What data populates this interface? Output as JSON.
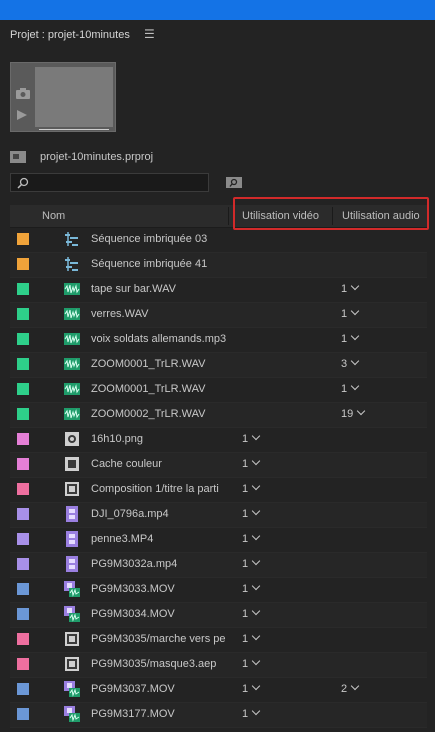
{
  "panel": {
    "title": "Projet : projet-10minutes",
    "menu_icon": "hamburger-icon",
    "project_file": "projet-10minutes.prproj",
    "search_placeholder": ""
  },
  "columns": {
    "name": "Nom",
    "video_usage": "Utilisation vidéo",
    "audio_usage": "Utilisation audio"
  },
  "colors": {
    "accent": "#1473e6",
    "highlight": "#d22a2a",
    "orange": "#f0a33a",
    "green": "#2ecf8a",
    "pink": "#e57fd6",
    "rose": "#ee6f9f",
    "lavender": "#a890e8",
    "blue": "#6b97d6"
  },
  "items": [
    {
      "name": "Séquence imbriquée 03",
      "icon": "sequence-icon",
      "label_color": "orange",
      "video": "",
      "audio": ""
    },
    {
      "name": "Séquence imbriquée 41",
      "icon": "sequence-icon",
      "label_color": "orange",
      "video": "",
      "audio": ""
    },
    {
      "name": "tape sur bar.WAV",
      "icon": "audio-icon",
      "label_color": "green",
      "video": "",
      "audio": "1"
    },
    {
      "name": "verres.WAV",
      "icon": "audio-icon",
      "label_color": "green",
      "video": "",
      "audio": "1"
    },
    {
      "name": "voix soldats allemands.mp3",
      "icon": "audio-icon",
      "label_color": "green",
      "video": "",
      "audio": "1"
    },
    {
      "name": "ZOOM0001_TrLR.WAV",
      "icon": "audio-icon",
      "label_color": "green",
      "video": "",
      "audio": "3"
    },
    {
      "name": "ZOOM0001_TrLR.WAV",
      "icon": "audio-icon",
      "label_color": "green",
      "video": "",
      "audio": "1"
    },
    {
      "name": "ZOOM0002_TrLR.WAV",
      "icon": "audio-icon",
      "label_color": "green",
      "video": "",
      "audio": "19"
    },
    {
      "name": "16h10.png",
      "icon": "image-icon",
      "label_color": "pink",
      "video": "1",
      "audio": ""
    },
    {
      "name": "Cache couleur",
      "icon": "color-matte-icon",
      "label_color": "pink",
      "video": "1",
      "audio": ""
    },
    {
      "name": "Composition 1/titre la parti",
      "icon": "composition-icon",
      "label_color": "rose",
      "video": "1",
      "audio": ""
    },
    {
      "name": "DJI_0796a.mp4",
      "icon": "video-icon",
      "label_color": "lavender",
      "video": "1",
      "audio": ""
    },
    {
      "name": "penne3.MP4",
      "icon": "video-icon",
      "label_color": "lavender",
      "video": "1",
      "audio": ""
    },
    {
      "name": "PG9M3032a.mp4",
      "icon": "video-icon",
      "label_color": "lavender",
      "video": "1",
      "audio": ""
    },
    {
      "name": "PG9M3033.MOV",
      "icon": "av-clip-icon",
      "label_color": "blue",
      "video": "1",
      "audio": ""
    },
    {
      "name": "PG9M3034.MOV",
      "icon": "av-clip-icon",
      "label_color": "blue",
      "video": "1",
      "audio": ""
    },
    {
      "name": "PG9M3035/marche vers pe",
      "icon": "composition-icon",
      "label_color": "rose",
      "video": "1",
      "audio": ""
    },
    {
      "name": "PG9M3035/masque3.aep",
      "icon": "composition-icon",
      "label_color": "rose",
      "video": "1",
      "audio": ""
    },
    {
      "name": "PG9M3037.MOV",
      "icon": "av-clip-icon",
      "label_color": "blue",
      "video": "1",
      "audio": "2"
    },
    {
      "name": "PG9M3177.MOV",
      "icon": "av-clip-icon",
      "label_color": "blue",
      "video": "1",
      "audio": ""
    }
  ]
}
